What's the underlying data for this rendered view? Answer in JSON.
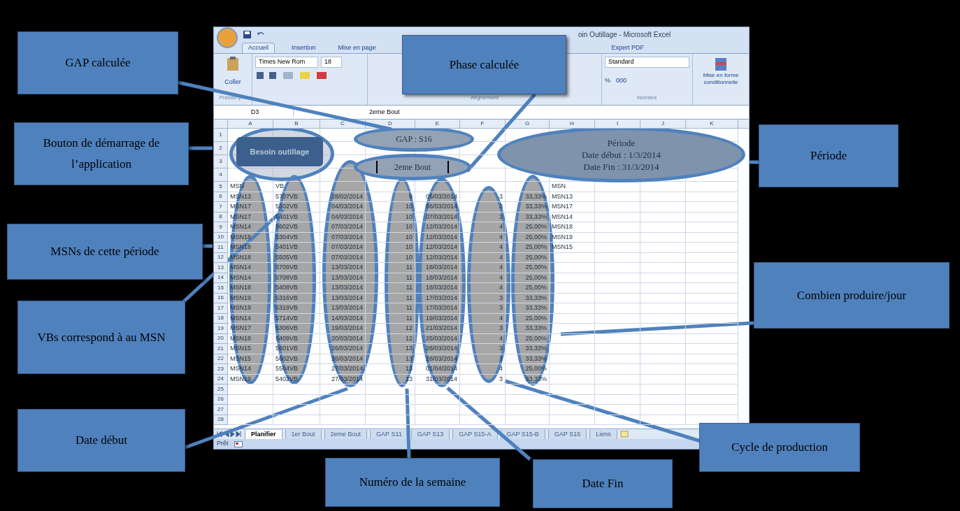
{
  "window": {
    "title": "oin Outillage - Microsoft Excel"
  },
  "ribbon": {
    "tabs": [
      {
        "label": "Accueil",
        "selected": true
      },
      {
        "label": "Insertion",
        "selected": false
      },
      {
        "label": "Mise en page",
        "selected": false
      },
      {
        "label": "Expert PDF",
        "selected": false
      }
    ],
    "clipboard": {
      "paste": "Coller",
      "group": "Presse-p..."
    },
    "font": {
      "name": "Times New Rom",
      "size": "18"
    },
    "alignment": {
      "group": "Alignement"
    },
    "number": {
      "format": "Standard",
      "percent": "%",
      "thousands": "000",
      "group": "Nombre"
    },
    "styles": {
      "conditional": "Mise en forme conditionnelle"
    }
  },
  "formula_bar": {
    "cell": "D3",
    "value": "2eme Bout"
  },
  "sheet": {
    "columns": [
      "A",
      "B",
      "C",
      "D",
      "E",
      "F",
      "G",
      "H",
      "I",
      "J",
      "K"
    ],
    "row_numbers": [
      "1",
      "2",
      "3",
      "4",
      "5",
      "6",
      "7",
      "8",
      "9",
      "10",
      "11",
      "12",
      "13",
      "14",
      "15",
      "16",
      "17",
      "18",
      "19",
      "20",
      "21",
      "22",
      "23",
      "24",
      "25",
      "26",
      "27",
      "28"
    ],
    "header": [
      "MSN",
      "VB"
    ],
    "rows": [
      [
        "MSN13",
        "5707VB",
        "28/02/2014",
        "9",
        "05/03/2014",
        "3",
        "33,33%"
      ],
      [
        "MSN17",
        "5302VB",
        "04/03/2014",
        "10",
        "06/03/2014",
        "3",
        "33,33%"
      ],
      [
        "MSN17",
        "5401VB",
        "04/03/2014",
        "10",
        "07/03/2014",
        "3",
        "33,33%"
      ],
      [
        "MSN14",
        "5602VB",
        "07/03/2014",
        "10",
        "12/03/2014",
        "4",
        "25,00%"
      ],
      [
        "MSN18",
        "5304VB",
        "07/03/2014",
        "10",
        "12/03/2014",
        "4",
        "25,00%"
      ],
      [
        "MSN18",
        "5401VB",
        "07/03/2014",
        "10",
        "12/03/2014",
        "4",
        "25,00%"
      ],
      [
        "MSN18",
        "5505VB",
        "07/03/2014",
        "10",
        "12/03/2014",
        "4",
        "25,00%"
      ],
      [
        "MSN14",
        "5709VB",
        "13/03/2014",
        "11",
        "18/03/2014",
        "4",
        "25,00%"
      ],
      [
        "MSN14",
        "5708VB",
        "13/03/2014",
        "11",
        "18/03/2014",
        "4",
        "25,00%"
      ],
      [
        "MSN18",
        "5408VB",
        "13/03/2014",
        "11",
        "18/03/2014",
        "4",
        "25,00%"
      ],
      [
        "MSN19",
        "5316VB",
        "13/03/2014",
        "11",
        "17/03/2014",
        "3",
        "33,33%"
      ],
      [
        "MSN19",
        "5319VB",
        "13/03/2014",
        "11",
        "17/03/2014",
        "3",
        "33,33%"
      ],
      [
        "MSN14",
        "5714VB",
        "14/03/2014",
        "11",
        "19/03/2014",
        "4",
        "25,00%"
      ],
      [
        "MSN17",
        "5306VB",
        "19/03/2014",
        "12",
        "21/03/2014",
        "3",
        "33,33%"
      ],
      [
        "MSN18",
        "5409VB",
        "20/03/2014",
        "12",
        "25/03/2014",
        "4",
        "25,00%"
      ],
      [
        "MSN15",
        "5601VB",
        "26/03/2014",
        "13",
        "28/03/2014",
        "3",
        "33,33%"
      ],
      [
        "MSN15",
        "5602VB",
        "26/03/2014",
        "13",
        "28/03/2014",
        "3",
        "33,33%"
      ],
      [
        "MSN14",
        "5504VB",
        "27/03/2014",
        "13",
        "01/04/2014",
        "4",
        "25,00%"
      ],
      [
        "MSN19",
        "5402VB",
        "27/03/2014",
        "13",
        "31/03/2014",
        "3",
        "33,33%"
      ]
    ],
    "summary": {
      "header": "MSN",
      "items": [
        "MSN13",
        "MSN17",
        "MSN14",
        "MSN18",
        "MSN19",
        "MSN15"
      ]
    }
  },
  "shapes": {
    "start_button": "Besoin outillage",
    "gap": "GAP : S16",
    "phase": "2eme Bout",
    "period": [
      "Période",
      "Date début : 1/3/2014",
      "Date Fin : 31/3/2014"
    ]
  },
  "sheet_tabs": [
    {
      "label": "Planifier",
      "selected": true
    },
    {
      "label": "1er Bout",
      "selected": false
    },
    {
      "label": "2eme Bout",
      "selected": false
    },
    {
      "label": "GAP S11",
      "selected": false
    },
    {
      "label": "GAP S13",
      "selected": false
    },
    {
      "label": "GAP S15-A",
      "selected": false
    },
    {
      "label": "GAP S15-B",
      "selected": false
    },
    {
      "label": "GAP S16",
      "selected": false
    },
    {
      "label": "Liens",
      "selected": false
    }
  ],
  "status_bar": {
    "text": "Prêt"
  },
  "callouts": [
    {
      "text": "GAP calculée"
    },
    {
      "text": "Phase calculée"
    },
    {
      "text": "Bouton de démarrage de l’application"
    },
    {
      "text": "Période"
    },
    {
      "text": "MSNs de cette période"
    },
    {
      "text": "Combien produire/jour"
    },
    {
      "text": "VBs correspond à au MSN"
    },
    {
      "text": "Date début"
    },
    {
      "text": "Numéro de la semaine"
    },
    {
      "text": "Date Fin"
    },
    {
      "text": "Cycle de production"
    }
  ]
}
